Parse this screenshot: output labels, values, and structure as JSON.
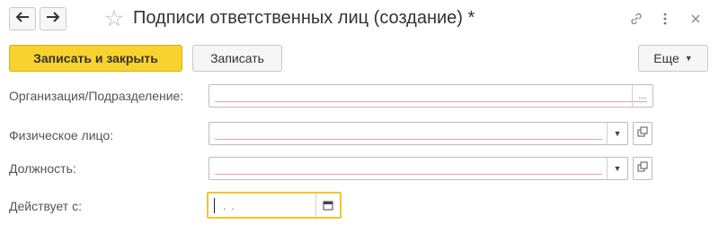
{
  "window": {
    "title": "Подписи ответственных лиц (создание) *",
    "back_icon": "arrow-left-icon",
    "forward_icon": "arrow-right-icon",
    "favorite_icon": "star-icon",
    "link_icon": "link-icon",
    "menu_icon": "more-vertical-icon",
    "close_icon": "close-icon"
  },
  "toolbar": {
    "save_and_close_label": "Записать и закрыть",
    "save_label": "Записать",
    "more_label": "Еще"
  },
  "form": {
    "organization": {
      "label": "Организация/Подразделение:",
      "value": "",
      "select_label": "..."
    },
    "individual": {
      "label": "Физическое лицо:",
      "value": ""
    },
    "position": {
      "label": "Должность:",
      "value": ""
    },
    "valid_from": {
      "label": "Действует с:",
      "value": ".  ."
    }
  },
  "colors": {
    "primary_button": "#f8d22f",
    "required_underline": "#f0a0a0",
    "focus_border": "#f2c62a"
  }
}
